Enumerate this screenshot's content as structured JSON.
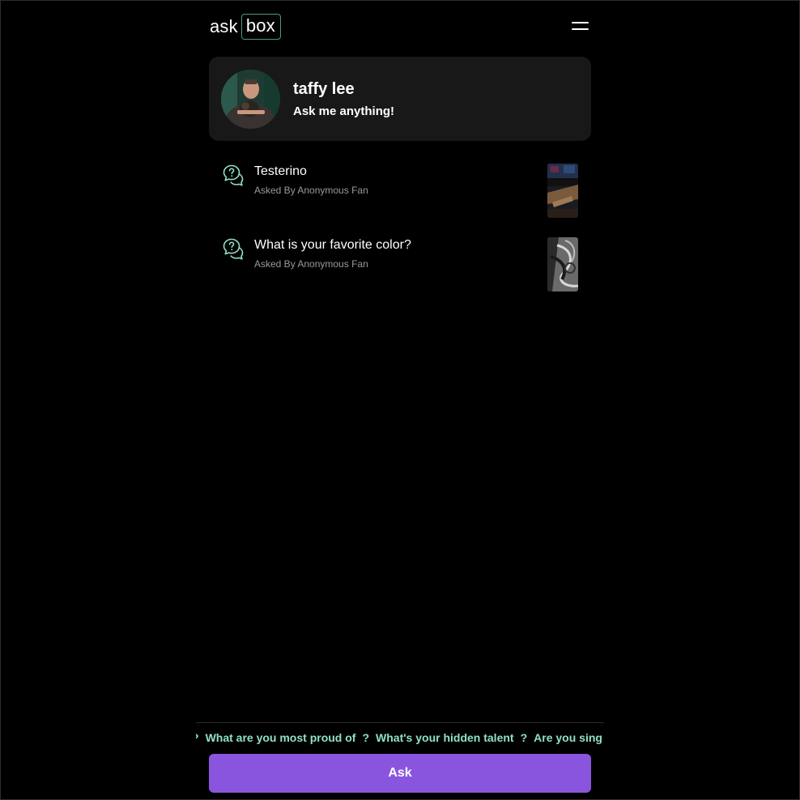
{
  "header": {
    "logo_ask": "ask",
    "logo_box": "box",
    "menu_icon": "hamburger-menu-icon"
  },
  "profile": {
    "name": "taffy lee",
    "tagline": "Ask me anything!",
    "avatar_icon": "profile-photo"
  },
  "questions": [
    {
      "text": "Testerino",
      "meta": "Asked By Anonymous Fan",
      "icon": "question-bubble-icon",
      "thumbnail": "answer-thumbnail"
    },
    {
      "text": "What is your favorite color?",
      "meta": "Asked By Anonymous Fan",
      "icon": "question-bubble-icon",
      "thumbnail": "answer-thumbnail"
    }
  ],
  "ticker": {
    "items": [
      "?",
      "What are you most proud of",
      "?",
      "What's your hidden talent",
      "?",
      "Are you sing"
    ]
  },
  "ask_button": {
    "label": "Ask"
  },
  "colors": {
    "background": "#000000",
    "card": "#181818",
    "accent_teal": "#8fe0c6",
    "accent_purple": "#8a55de",
    "muted_text": "#9a9a9a"
  }
}
